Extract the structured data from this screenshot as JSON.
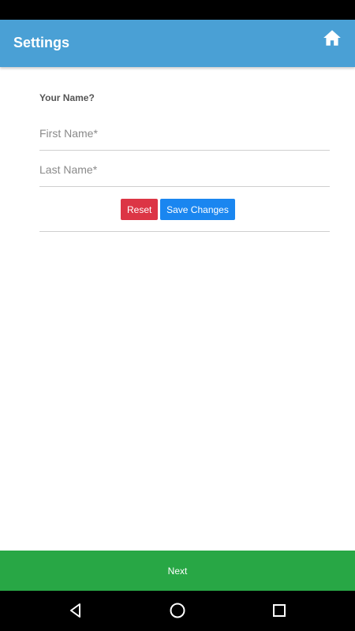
{
  "app_bar": {
    "title": "Settings",
    "home_icon": "home-icon",
    "background": "#4aa0d5"
  },
  "form": {
    "section_label": "Your Name?",
    "first_name": {
      "value": "",
      "placeholder": "First Name*"
    },
    "last_name": {
      "value": "",
      "placeholder": "Last Name*"
    },
    "reset_label": "Reset",
    "save_label": "Save Changes"
  },
  "footer": {
    "next_label": "Next",
    "color": "#28a745"
  },
  "system_nav": {
    "icons": [
      "back-icon",
      "home-circle-icon",
      "recent-apps-icon"
    ]
  },
  "colors": {
    "reset": "#dc3545",
    "save": "#1a86f0"
  }
}
